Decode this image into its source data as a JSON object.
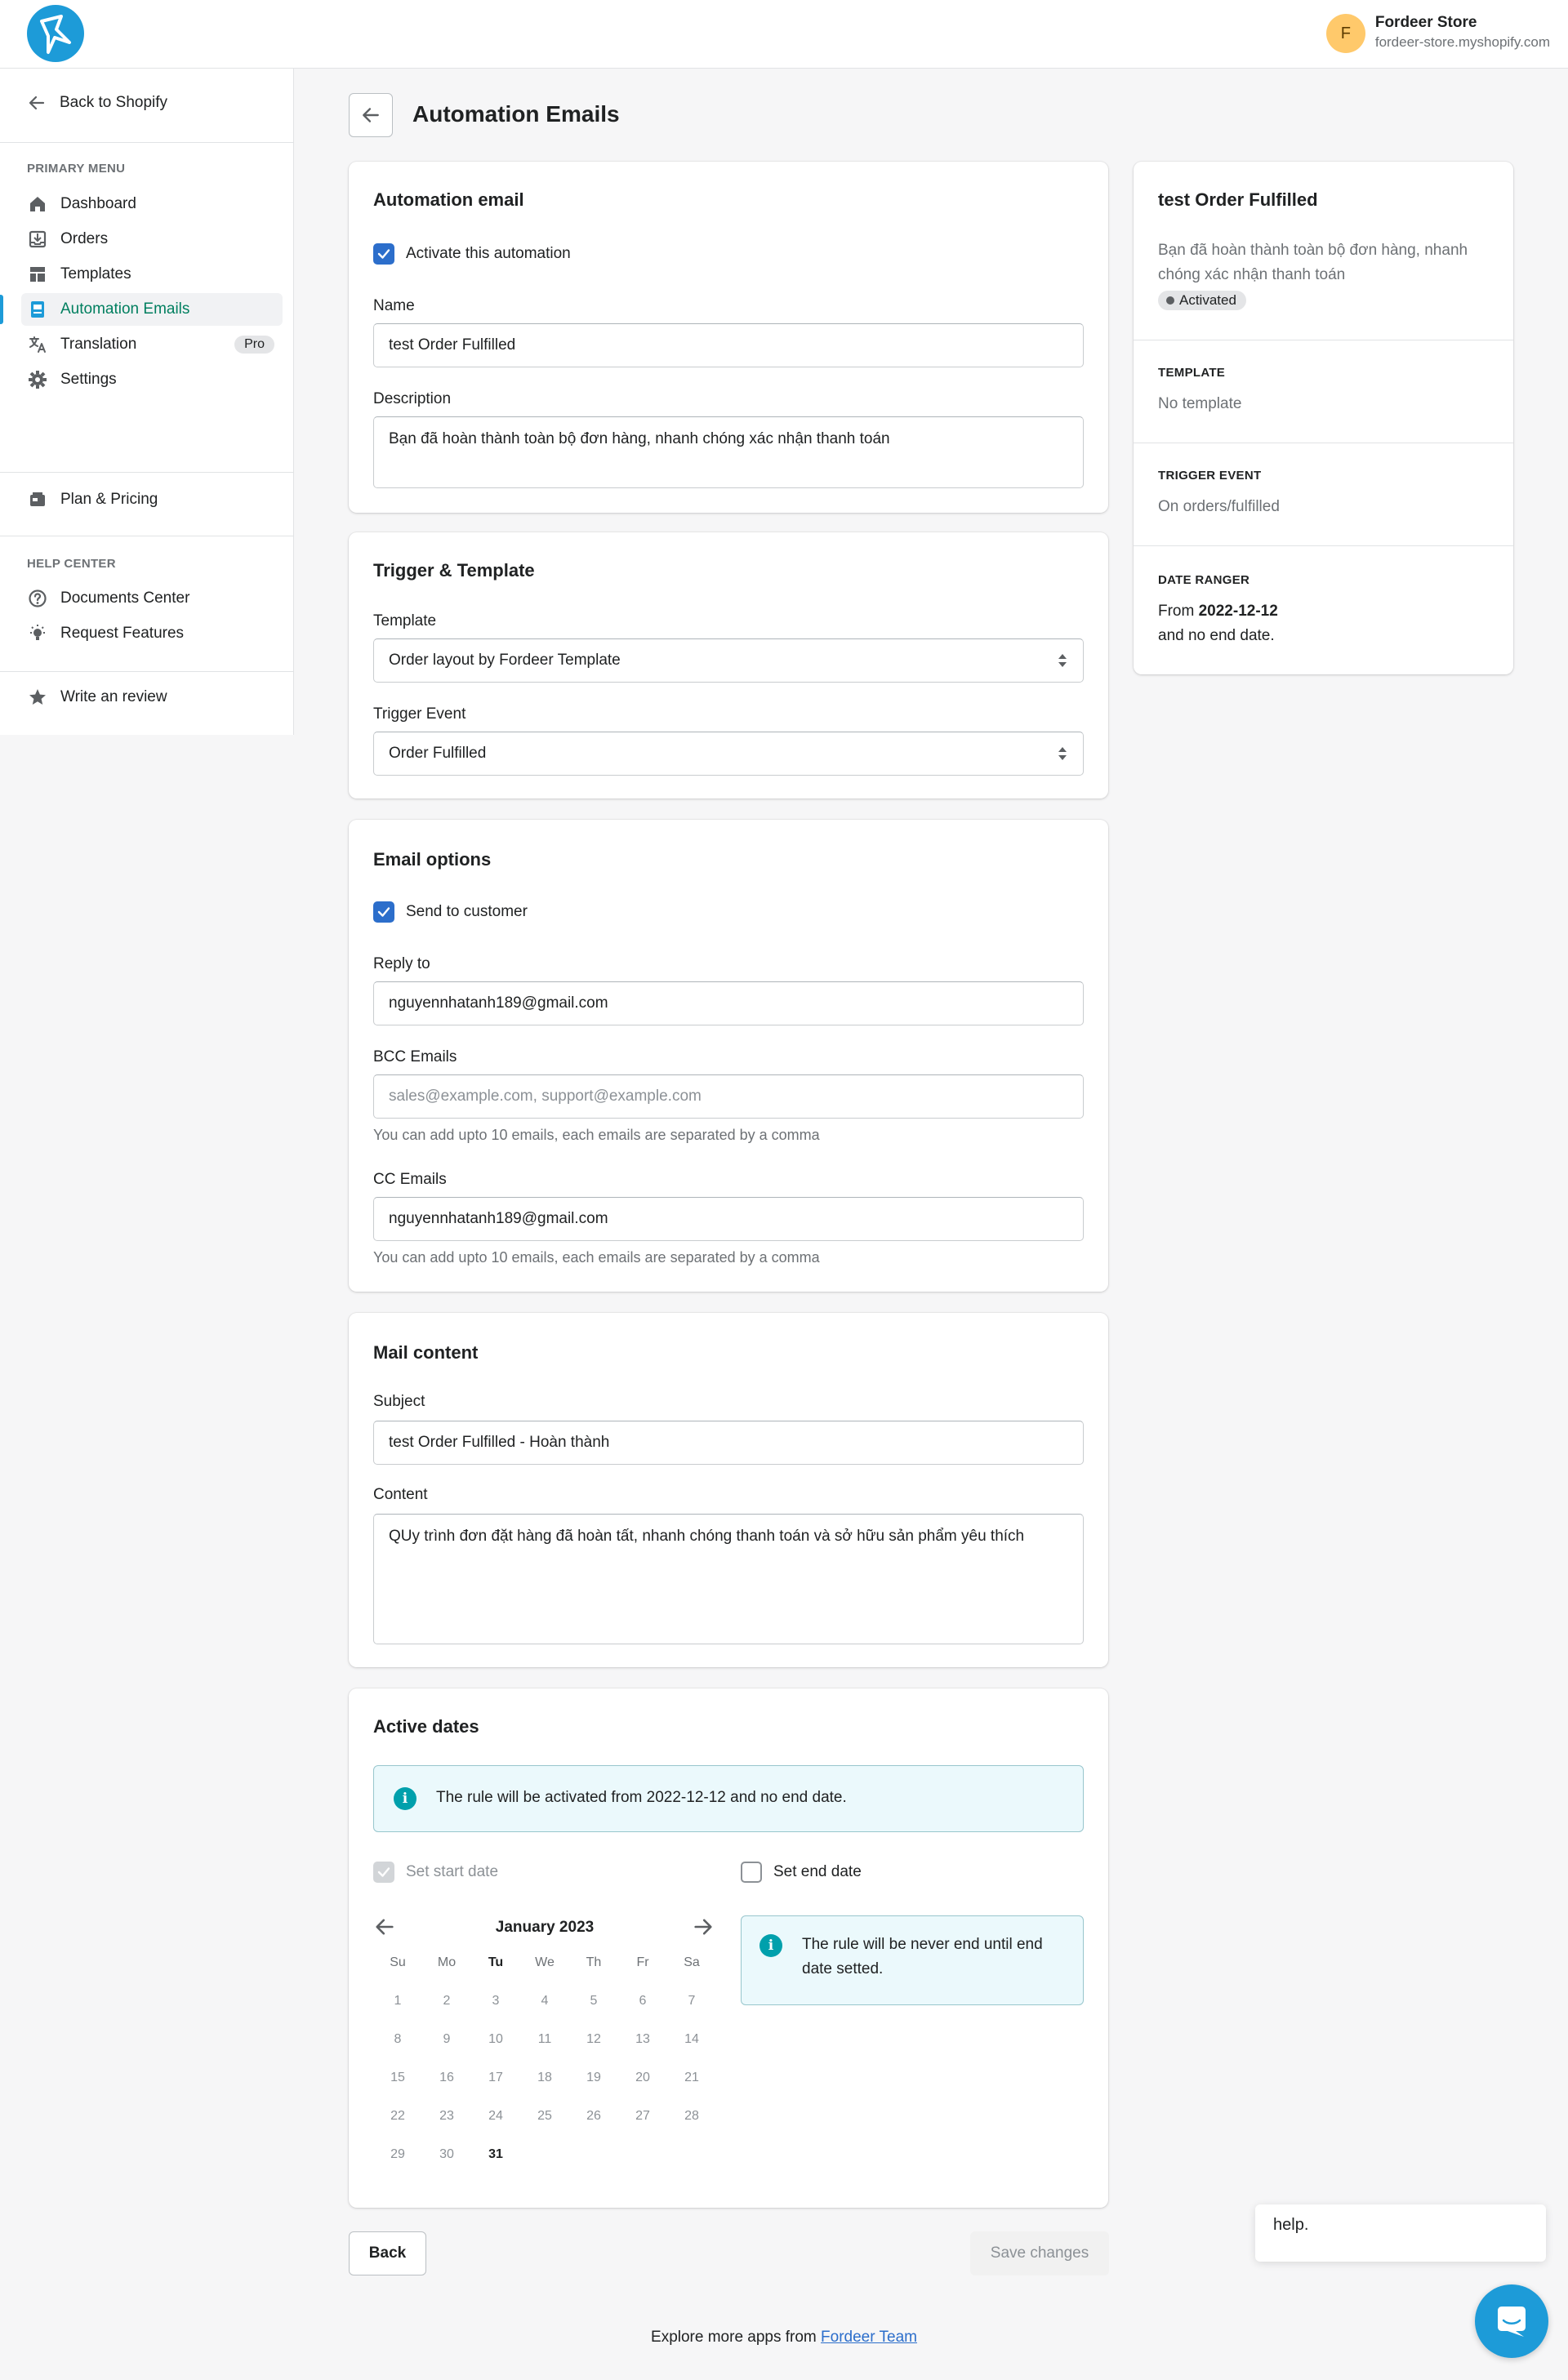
{
  "topbar": {
    "store_initial": "F",
    "store_name": "Fordeer Store",
    "store_domain": "fordeer-store.myshopify.com"
  },
  "sidebar": {
    "back_label": "Back to Shopify",
    "primary_heading": "PRIMARY MENU",
    "items": [
      {
        "label": "Dashboard",
        "icon": "home-icon"
      },
      {
        "label": "Orders",
        "icon": "orders-icon"
      },
      {
        "label": "Templates",
        "icon": "templates-icon"
      },
      {
        "label": "Automation Emails",
        "icon": "email-icon",
        "active": true
      },
      {
        "label": "Translation",
        "icon": "translate-icon",
        "badge": "Pro"
      },
      {
        "label": "Settings",
        "icon": "gear-icon"
      }
    ],
    "plan_label": "Plan & Pricing",
    "help_heading": "HELP CENTER",
    "help_items": [
      {
        "label": "Documents Center",
        "icon": "question-icon"
      },
      {
        "label": "Request Features",
        "icon": "lightbulb-icon"
      }
    ],
    "review_label": "Write an review"
  },
  "page": {
    "title": "Automation Emails"
  },
  "automation": {
    "title": "Automation email",
    "activate_label": "Activate this automation",
    "activate_checked": true,
    "name_label": "Name",
    "name_value": "test Order Fulfilled",
    "description_label": "Description",
    "description_value": "Bạn đã hoàn thành toàn bộ đơn hàng, nhanh chóng xác nhận thanh toán"
  },
  "trigger": {
    "title": "Trigger & Template",
    "template_label": "Template",
    "template_value": "Order layout by Fordeer Template",
    "event_label": "Trigger Event",
    "event_value": "Order Fulfilled"
  },
  "email_options": {
    "title": "Email options",
    "send_label": "Send to customer",
    "send_checked": true,
    "reply_label": "Reply to",
    "reply_value": "nguyennhatanh189@gmail.com",
    "bcc_label": "BCC Emails",
    "bcc_placeholder": "sales@example.com, support@example.com",
    "bcc_help": "You can add upto 10 emails, each emails are separated by a comma",
    "cc_label": "CC Emails",
    "cc_value": "nguyennhatanh189@gmail.com",
    "cc_help": "You can add upto 10 emails, each emails are separated by a comma"
  },
  "mail_content": {
    "title": "Mail content",
    "subject_label": "Subject",
    "subject_value": "test Order Fulfilled - Hoàn thành",
    "content_label": "Content",
    "content_value": "QUy trình đơn đặt hàng đã hoàn tất, nhanh chóng thanh toán và sở hữu sản phẩm yêu thích"
  },
  "active_dates": {
    "title": "Active dates",
    "banner_text": "The rule will be activated from 2022-12-12 and no end date.",
    "start_label": "Set start date",
    "end_label": "Set end date",
    "end_banner": "The rule will be never end until end date setted.",
    "calendar": {
      "month": "January 2023",
      "weekdays": [
        "Su",
        "Mo",
        "Tu",
        "We",
        "Th",
        "Fr",
        "Sa"
      ],
      "today_weekday_index": 2,
      "first_day_offset": 0,
      "days": 31,
      "bold_day": 31
    }
  },
  "summary": {
    "title": "test Order Fulfilled",
    "description": "Bạn đã hoàn thành toàn bộ đơn hàng, nhanh chóng xác nhận thanh toán",
    "status": "Activated",
    "template_heading": "TEMPLATE",
    "template_value": "No template",
    "trigger_heading": "TRIGGER EVENT",
    "trigger_value": "On orders/fulfilled",
    "date_heading": "DATE RANGER",
    "date_from_label": "From",
    "date_from_value": "2022-12-12",
    "date_end_text": "and no end date."
  },
  "actions": {
    "back_label": "Back",
    "save_label": "Save changes"
  },
  "footer": {
    "prefix": "Explore more apps from",
    "link": "Fordeer Team"
  },
  "chat": {
    "popup_text": "help."
  },
  "colors": {
    "accent": "#1d9bd8",
    "primary": "#2c6ecb",
    "active_nav_text": "#007f5f",
    "info_banner_bg": "#ebf9fc"
  }
}
